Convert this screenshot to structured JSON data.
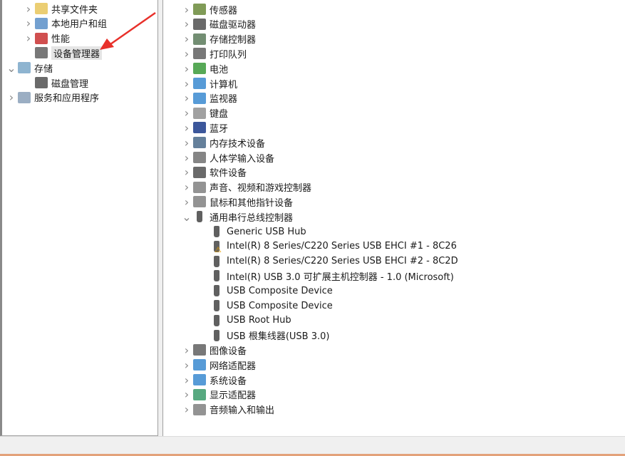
{
  "left_tree": [
    {
      "label": "共享文件夹",
      "level": 2,
      "chevron": "right",
      "icon": "shared-folder-icon",
      "color": "#e8c65a"
    },
    {
      "label": "本地用户和组",
      "level": 2,
      "chevron": "right",
      "icon": "users-icon",
      "color": "#5a8fc8"
    },
    {
      "label": "性能",
      "level": 2,
      "chevron": "right",
      "icon": "performance-icon",
      "color": "#c83030"
    },
    {
      "label": "设备管理器",
      "level": 2,
      "chevron": "",
      "icon": "device-manager-icon",
      "color": "#606060",
      "selected": true
    },
    {
      "label": "存储",
      "level": 1,
      "chevron": "down",
      "icon": "storage-icon",
      "color": "#7aa7c8"
    },
    {
      "label": "磁盘管理",
      "level": 2,
      "chevron": "",
      "icon": "disk-management-icon",
      "color": "#505050"
    },
    {
      "label": "服务和应用程序",
      "level": 1,
      "chevron": "right",
      "icon": "services-icon",
      "color": "#8aa0b8"
    }
  ],
  "device_tree": [
    {
      "label": "传感器",
      "icon": "sensor-icon",
      "chevron": "right",
      "color": "#6a8a3a"
    },
    {
      "label": "磁盘驱动器",
      "icon": "disk-drive-icon",
      "chevron": "right",
      "color": "#505050"
    },
    {
      "label": "存储控制器",
      "icon": "storage-controller-icon",
      "chevron": "right",
      "color": "#5a7a5a"
    },
    {
      "label": "打印队列",
      "icon": "printer-icon",
      "chevron": "right",
      "color": "#606060"
    },
    {
      "label": "电池",
      "icon": "battery-icon",
      "chevron": "right",
      "color": "#3a9a3a"
    },
    {
      "label": "计算机",
      "icon": "computer-icon",
      "chevron": "right",
      "color": "#3a8ad0"
    },
    {
      "label": "监视器",
      "icon": "monitor-icon",
      "chevron": "right",
      "color": "#3a8ad0"
    },
    {
      "label": "键盘",
      "icon": "keyboard-icon",
      "chevron": "right",
      "color": "#909090"
    },
    {
      "label": "蓝牙",
      "icon": "bluetooth-icon",
      "chevron": "right",
      "color": "#1a3a8a"
    },
    {
      "label": "内存技术设备",
      "icon": "memory-icon",
      "chevron": "right",
      "color": "#4a6a8a"
    },
    {
      "label": "人体学输入设备",
      "icon": "hid-icon",
      "chevron": "right",
      "color": "#707070"
    },
    {
      "label": "软件设备",
      "icon": "software-device-icon",
      "chevron": "right",
      "color": "#505050"
    },
    {
      "label": "声音、视频和游戏控制器",
      "icon": "sound-icon",
      "chevron": "right",
      "color": "#808080"
    },
    {
      "label": "鼠标和其他指针设备",
      "icon": "mouse-icon",
      "chevron": "right",
      "color": "#808080"
    },
    {
      "label": "通用串行总线控制器",
      "icon": "usb-icon",
      "chevron": "down",
      "color": "#606060",
      "children": [
        {
          "label": "Generic USB Hub",
          "icon": "usb-icon"
        },
        {
          "label": "Intel(R) 8 Series/C220 Series USB EHCI #1 - 8C26",
          "icon": "usb-warning-icon",
          "warning": true
        },
        {
          "label": "Intel(R) 8 Series/C220 Series USB EHCI #2 - 8C2D",
          "icon": "usb-icon"
        },
        {
          "label": "Intel(R) USB 3.0 可扩展主机控制器 - 1.0 (Microsoft)",
          "icon": "usb-icon"
        },
        {
          "label": "USB Composite Device",
          "icon": "usb-icon"
        },
        {
          "label": "USB Composite Device",
          "icon": "usb-icon"
        },
        {
          "label": "USB Root Hub",
          "icon": "usb-icon"
        },
        {
          "label": "USB 根集线器(USB 3.0)",
          "icon": "usb-icon"
        }
      ]
    },
    {
      "label": "图像设备",
      "icon": "camera-icon",
      "chevron": "right",
      "color": "#606060"
    },
    {
      "label": "网络适配器",
      "icon": "network-icon",
      "chevron": "right",
      "color": "#3a8ad0"
    },
    {
      "label": "系统设备",
      "icon": "system-device-icon",
      "chevron": "right",
      "color": "#3a8ad0"
    },
    {
      "label": "显示适配器",
      "icon": "display-adapter-icon",
      "chevron": "right",
      "color": "#3a9a6a"
    },
    {
      "label": "音频输入和输出",
      "icon": "audio-icon",
      "chevron": "right",
      "color": "#808080"
    }
  ],
  "annotation": {
    "arrow_color": "#e8302a"
  }
}
